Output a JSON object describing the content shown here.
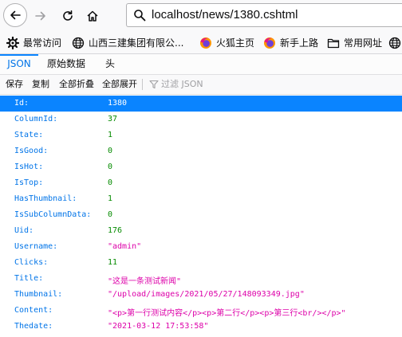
{
  "url": "localhost/news/1380.cshtml",
  "bookmarks": [
    {
      "label": "最常访问",
      "icon": "gear-icon"
    },
    {
      "label": "山西三建集团有限公...",
      "icon": "globe-icon"
    },
    {
      "label": "火狐主页",
      "icon": "firefox-icon"
    },
    {
      "label": "新手上路",
      "icon": "firefox-icon"
    },
    {
      "label": "常用网址",
      "icon": "folder-icon"
    },
    {
      "label": "",
      "icon": "globe-icon"
    }
  ],
  "tabs": [
    {
      "label": "JSON",
      "selected": true
    },
    {
      "label": "原始数据",
      "selected": false
    },
    {
      "label": "头",
      "selected": false
    }
  ],
  "toolbar": {
    "save": "保存",
    "copy": "复制",
    "collapse_all": "全部折叠",
    "expand_all": "全部展开",
    "filter": "过滤 JSON"
  },
  "rows": [
    {
      "key": "Id:",
      "value": "1380",
      "type": "number",
      "selected": true
    },
    {
      "key": "ColumnId:",
      "value": "37",
      "type": "number"
    },
    {
      "key": "State:",
      "value": "1",
      "type": "number"
    },
    {
      "key": "IsGood:",
      "value": "0",
      "type": "number"
    },
    {
      "key": "IsHot:",
      "value": "0",
      "type": "number"
    },
    {
      "key": "IsTop:",
      "value": "0",
      "type": "number"
    },
    {
      "key": "HasThumbnail:",
      "value": "1",
      "type": "number"
    },
    {
      "key": "IsSubColumnData:",
      "value": "0",
      "type": "number"
    },
    {
      "key": "Uid:",
      "value": "176",
      "type": "number"
    },
    {
      "key": "Username:",
      "value": "\"admin\"",
      "type": "string"
    },
    {
      "key": "Clicks:",
      "value": "11",
      "type": "number"
    },
    {
      "key": "Title:",
      "value": "\"这是一条测试新闻\"",
      "type": "string"
    },
    {
      "key": "Thumbnail:",
      "value": "\"/upload/images/2021/05/27/148093349.jpg\"",
      "type": "string"
    },
    {
      "key": "Content:",
      "value": "\"<p>第一行测试内容</p><p>第二行</p><p>第三行<br/></p>\"",
      "type": "string"
    },
    {
      "key": "Thedate:",
      "value": "\"2021-03-12 17:53:58\"",
      "type": "string"
    }
  ],
  "colors": {
    "key": "#0074e8",
    "number": "#058b00",
    "string": "#dd00a9",
    "selection": "#0a84ff"
  }
}
